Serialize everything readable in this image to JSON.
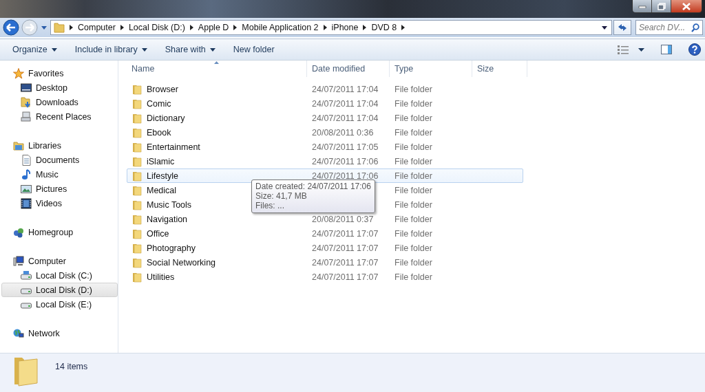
{
  "address_bar": {
    "breadcrumbs": [
      "Computer",
      "Local Disk (D:)",
      "Apple D",
      "Mobile Application 2",
      "iPhone",
      "DVD 8"
    ],
    "search": {
      "placeholder": "Search DV..."
    }
  },
  "toolbar": {
    "items": [
      {
        "label": "Organize",
        "dropdown": true
      },
      {
        "label": "Include in library",
        "dropdown": true
      },
      {
        "label": "Share with",
        "dropdown": true
      },
      {
        "label": "New folder",
        "dropdown": false
      }
    ]
  },
  "sidebar": {
    "groups": [
      {
        "label": "Favorites",
        "children": [
          {
            "label": "Desktop",
            "selected": false
          },
          {
            "label": "Downloads",
            "selected": false
          },
          {
            "label": "Recent Places",
            "selected": false
          }
        ]
      },
      {
        "label": "Libraries",
        "children": [
          {
            "label": "Documents",
            "selected": false
          },
          {
            "label": "Music",
            "selected": false
          },
          {
            "label": "Pictures",
            "selected": false
          },
          {
            "label": "Videos",
            "selected": false
          }
        ]
      },
      {
        "label": "Homegroup"
      },
      {
        "label": "Computer",
        "children": [
          {
            "label": "Local Disk (C:)",
            "selected": false
          },
          {
            "label": "Local Disk (D:)",
            "selected": true
          },
          {
            "label": "Local Disk (E:)",
            "selected": false
          }
        ]
      },
      {
        "label": "Network"
      }
    ]
  },
  "table": {
    "columns": [
      "Name",
      "Date modified",
      "Type",
      "Size"
    ],
    "rows": [
      {
        "name": "Browser",
        "date_modified": "24/07/2011 17:04",
        "type": "File folder",
        "hovered": false
      },
      {
        "name": "Comic",
        "date_modified": "24/07/2011 17:04",
        "type": "File folder",
        "hovered": false
      },
      {
        "name": "Dictionary",
        "date_modified": "24/07/2011 17:04",
        "type": "File folder",
        "hovered": false
      },
      {
        "name": "Ebook",
        "date_modified": "20/08/2011 0:36",
        "type": "File folder",
        "hovered": false
      },
      {
        "name": "Entertainment",
        "date_modified": "24/07/2011 17:05",
        "type": "File folder",
        "hovered": false
      },
      {
        "name": "iSlamic",
        "date_modified": "24/07/2011 17:06",
        "type": "File folder",
        "hovered": false
      },
      {
        "name": "Lifestyle",
        "date_modified": "24/07/2011 17:06",
        "type": "File folder",
        "hovered": true
      },
      {
        "name": "Medical",
        "type": "File folder",
        "hovered": false
      },
      {
        "name": "Music Tools",
        "type": "File folder",
        "hovered": false
      },
      {
        "name": "Navigation",
        "date_modified": "20/08/2011 0:37",
        "type": "File folder",
        "hovered": false
      },
      {
        "name": "Office",
        "date_modified": "24/07/2011 17:07",
        "type": "File folder",
        "hovered": false
      },
      {
        "name": "Photography",
        "date_modified": "24/07/2011 17:07",
        "type": "File folder",
        "hovered": false
      },
      {
        "name": "Social Networking",
        "date_modified": "24/07/2011 17:07",
        "type": "File folder",
        "hovered": false
      },
      {
        "name": "Utilities",
        "date_modified": "24/07/2011 17:07",
        "type": "File folder",
        "hovered": false
      }
    ]
  },
  "tooltip": {
    "lines": [
      "Date created: 24/07/2011 17:06",
      "Size: 41,7 MB",
      "Files: ..."
    ]
  },
  "status_bar": {
    "item_count": "14 items"
  }
}
